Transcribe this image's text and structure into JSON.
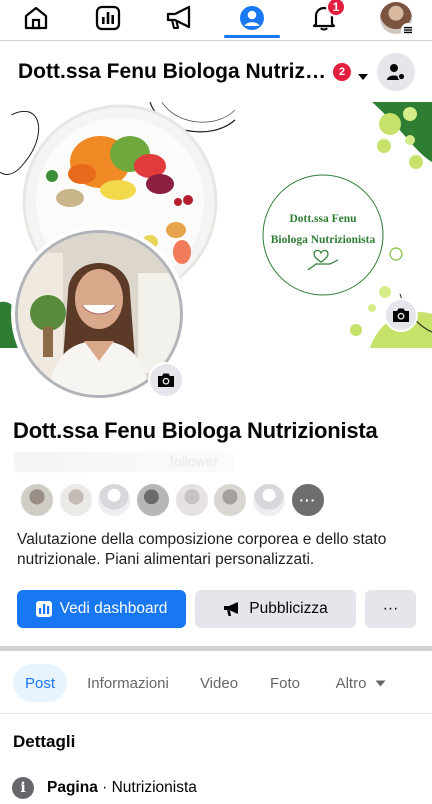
{
  "nav": {
    "notifications_count": "1",
    "active": "profile"
  },
  "header": {
    "title": "Dott.ssa Fenu Biologa Nutrizionista",
    "badge": "2"
  },
  "cover": {
    "logo_line1": "Dott.ssa Fenu",
    "logo_line2": "Biologa Nutrizionista"
  },
  "page": {
    "name": "Dott.ssa Fenu Biologa Nutrizionista",
    "followers_text": "follower",
    "more_followers": "···",
    "bio": "Valutazione della composizione corporea e dello stato nutrizionale. Piani alimentari personalizzati."
  },
  "actions": {
    "dashboard": "Vedi dashboard",
    "promote": "Pubblicizza",
    "more": "···"
  },
  "tabs": [
    {
      "label": "Post"
    },
    {
      "label": "Informazioni"
    },
    {
      "label": "Video"
    },
    {
      "label": "Foto"
    },
    {
      "label": "Altro"
    }
  ],
  "details": {
    "title": "Dettagli",
    "info_label": "Pagina",
    "info_sep": " · ",
    "info_value": "Nutrizionista"
  },
  "colors": {
    "accent": "#1877f2",
    "badge": "#e41e3f",
    "brand_green": "#2e7d32",
    "leaf_green": "#c6e26a"
  },
  "icons": [
    "home-icon",
    "dashboard-icon",
    "megaphone-icon",
    "profile-icon",
    "bell-icon",
    "camera-icon",
    "caret-down-icon",
    "user-gear-icon",
    "info-icon"
  ]
}
